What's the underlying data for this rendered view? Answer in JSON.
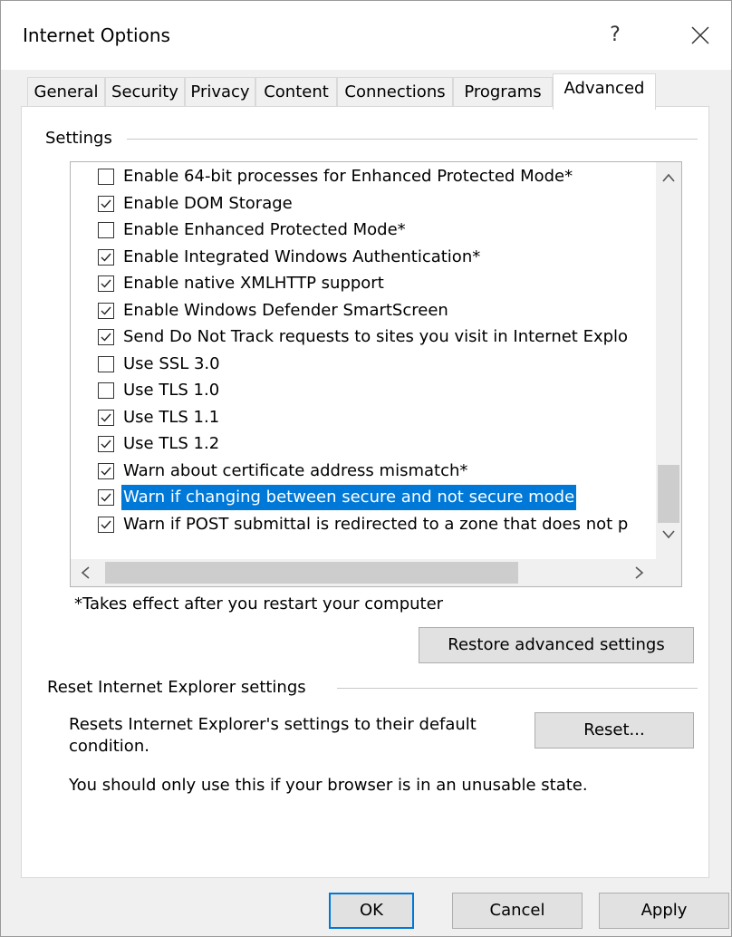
{
  "window": {
    "title": "Internet Options",
    "help_label": "?"
  },
  "tabs": [
    {
      "label": "General"
    },
    {
      "label": "Security"
    },
    {
      "label": "Privacy"
    },
    {
      "label": "Content"
    },
    {
      "label": "Connections"
    },
    {
      "label": "Programs"
    },
    {
      "label": "Advanced",
      "active": true
    }
  ],
  "settings": {
    "group_label": "Settings",
    "items": [
      {
        "label": "Enable 64-bit processes for Enhanced Protected Mode*",
        "checked": false
      },
      {
        "label": "Enable DOM Storage",
        "checked": true
      },
      {
        "label": "Enable Enhanced Protected Mode*",
        "checked": false
      },
      {
        "label": "Enable Integrated Windows Authentication*",
        "checked": true
      },
      {
        "label": "Enable native XMLHTTP support",
        "checked": true
      },
      {
        "label": "Enable Windows Defender SmartScreen",
        "checked": true
      },
      {
        "label": "Send Do Not Track requests to sites you visit in Internet Explo",
        "checked": true
      },
      {
        "label": "Use SSL 3.0",
        "checked": false
      },
      {
        "label": "Use TLS 1.0",
        "checked": false
      },
      {
        "label": "Use TLS 1.1",
        "checked": true
      },
      {
        "label": "Use TLS 1.2",
        "checked": true
      },
      {
        "label": "Warn about certificate address mismatch*",
        "checked": true
      },
      {
        "label": "Warn if changing between secure and not secure mode",
        "checked": true,
        "selected": true
      },
      {
        "label": "Warn if POST submittal is redirected to a zone that does not p",
        "checked": true
      }
    ],
    "footnote": "*Takes effect after you restart your computer",
    "restore_label": "Restore advanced settings"
  },
  "reset": {
    "group_label": "Reset Internet Explorer settings",
    "description": "Resets Internet Explorer's settings to their default condition.",
    "button_label": "Reset...",
    "warning": "You should only use this if your browser is in an unusable state."
  },
  "footer": {
    "ok_label": "OK",
    "cancel_label": "Cancel",
    "apply_label": "Apply"
  },
  "colors": {
    "accent": "#0078d7",
    "selection_text": "#ffffff"
  }
}
